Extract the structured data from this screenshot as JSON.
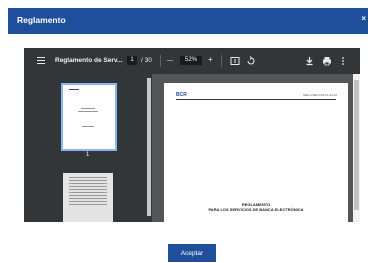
{
  "dialog": {
    "title": "Reglamento",
    "close_glyph": "×",
    "accept_label": "Aceptar"
  },
  "pdf": {
    "doc_name": "Reglamento de Serv...",
    "current_page": "1",
    "page_sep": "/ 30",
    "zoom_minus": "—",
    "zoom": "52%",
    "zoom_plus": "+",
    "thumbnail_page_number": "1",
    "page_header_code": "REG-CNE-0.05-12-04-12",
    "logo_text": "BCR",
    "doc_title": "REGLAMENTO",
    "doc_subtitle": "PARA LOS SERVICIOS DE BANCA ELECTRÓNICA"
  },
  "icons": {
    "menu": "menu-icon",
    "fit_page": "fit-page-icon",
    "rotate": "rotate-icon",
    "download": "download-icon",
    "print": "print-icon",
    "more": "more-vert-icon"
  },
  "colors": {
    "brand": "#1f4e9b",
    "toolbar": "#323639",
    "viewer_bg": "#525659"
  }
}
